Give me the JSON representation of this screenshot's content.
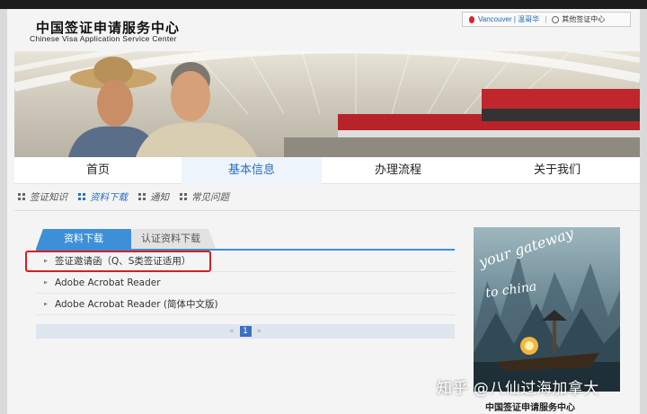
{
  "header": {
    "logo_cn": "中国签证申请服务中心",
    "logo_en": "Chinese Visa Application Service Center",
    "city": "Vancouver | 温哥华",
    "other_centers": "其他签证中心"
  },
  "nav": {
    "tabs": [
      {
        "label": "首页"
      },
      {
        "label": "基本信息"
      },
      {
        "label": "办理流程"
      },
      {
        "label": "关于我们"
      }
    ]
  },
  "subnav": {
    "items": [
      {
        "label": "签证知识"
      },
      {
        "label": "资料下载"
      },
      {
        "label": "通知"
      },
      {
        "label": "常见问题"
      }
    ]
  },
  "downloads": {
    "tab_active": "资料下载",
    "tab_other": "认证资料下载",
    "items": [
      {
        "label": "签证邀请函（Q、S类签证适用）"
      },
      {
        "label": "Adobe Acrobat Reader"
      },
      {
        "label": "Adobe Acrobat Reader (简体中文版)"
      }
    ],
    "pager": {
      "prev": "«",
      "current": "1",
      "next": "»"
    }
  },
  "ad": {
    "line1": "your gateway",
    "line2": "to china",
    "footer": "中国签证申请服务中心"
  },
  "watermark": "知乎 @八仙过海加拿大",
  "colors": {
    "accent": "#3d8fd8",
    "highlight": "#d42020"
  }
}
